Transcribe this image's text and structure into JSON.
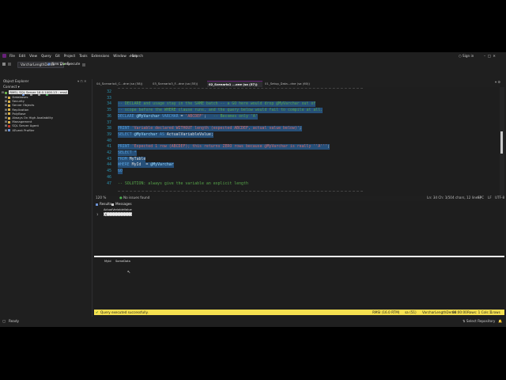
{
  "titlebar": {
    "menus": [
      "File",
      "Edit",
      "View",
      "Query",
      "Git",
      "Project",
      "Tools",
      "Extensions",
      "Window",
      "Help"
    ],
    "search": "Search",
    "signin": "Sign in"
  },
  "toolbar": {
    "database": "VarcharLengthDemo",
    "execute": "Execute",
    "new_query": "New Query"
  },
  "explorer": {
    "title": "Object Explorer",
    "connect": "Connect",
    "server": "RMSI, SQL Server 16.0.1000.13 - rmsi\\",
    "items": [
      "Databases",
      "Security",
      "Server Objects",
      "Replication",
      "PolyBase",
      "Always On High Availability",
      "Management",
      "SQL Server Agent",
      "XEvent Profiler"
    ]
  },
  "tabs": [
    "04_Scenario4_C...dne (sa (58))",
    "03_Scenario3_F...dne (sa (55))",
    "02_Scenario1 ...one (sa (57))",
    "01_Setup_Data...dne (sa (60))"
  ],
  "active_tab_index": 2,
  "editor": {
    "lines": [
      {
        "n": "32",
        "t": ""
      },
      {
        "n": "33",
        "t": ""
      },
      {
        "n": "34",
        "t": "-- DECLARE and usage stay in the SAME batch -- a GO here would drop @MyVarchar out of",
        "c": "cm",
        "sel": true
      },
      {
        "n": "35",
        "t": "-- scope before the WHERE clause runs, and the query below would fail to compile at all.",
        "c": "cm",
        "sel": true
      },
      {
        "n": "36",
        "t": "DECLARE @MyVarchar VARCHAR = 'ABCDEF';   -- Becomes only 'A'",
        "c": "mix1",
        "sel": true
      },
      {
        "n": "37",
        "t": ""
      },
      {
        "n": "38",
        "t": "PRINT 'Variable declared WITHOUT length (expected ABCDEF, actual value below)';",
        "c": "mix2",
        "sel": true
      },
      {
        "n": "39",
        "t": "SELECT @MyVarchar AS ActualVariableValue;",
        "c": "mix3",
        "sel": true
      },
      {
        "n": "40",
        "t": ""
      },
      {
        "n": "41",
        "t": "PRINT 'Expected 1 row (ABCDEF); this returns ZERO rows because @MyVarchar is really ''A''';",
        "c": "mix2",
        "sel": true
      },
      {
        "n": "42",
        "t": "SELECT *",
        "c": "kw",
        "sel": true
      },
      {
        "n": "43",
        "t": "FROM MyTable",
        "c": "mix4",
        "sel": true
      },
      {
        "n": "44",
        "t": "WHERE MyId  = @MyVarchar",
        "c": "mix5",
        "sel": true
      },
      {
        "n": "45",
        "t": "GO",
        "c": "kw",
        "sel": true
      },
      {
        "n": "46",
        "t": ""
      },
      {
        "n": "47",
        "t": "-- SOLUTION: always give the variable an explicit length",
        "c": "cm",
        "sel": false
      }
    ],
    "zoom": "120 %",
    "issues": "No issues found",
    "position": "Ln: 34  Ch: 1",
    "sel_info": "(504 chars, 12 lines)",
    "spc": "SPC",
    "crlf": "LF",
    "enc": "UTF-8"
  },
  "results": {
    "tabs": [
      "Results",
      "Messages"
    ],
    "grid1": {
      "header": "ActualVariableValue",
      "row_no": "1",
      "value": "A"
    },
    "grid2": {
      "headers": [
        "MyId",
        "SomeData"
      ]
    }
  },
  "status": {
    "message": "Query executed successfully.",
    "server": "RMSI (16.0 RTM)",
    "user": "sa (51)",
    "db": "VarcharLengthDemo",
    "time": "00:00:00",
    "rows": "Rows: 1  Cols: 1",
    "rows2": "1 rows"
  },
  "appstatus": {
    "ready": "Ready",
    "repo": "Select Repository"
  },
  "colors": {
    "accent": "#68217a",
    "status_yellow": "#f5e050",
    "selection": "#264f78"
  }
}
